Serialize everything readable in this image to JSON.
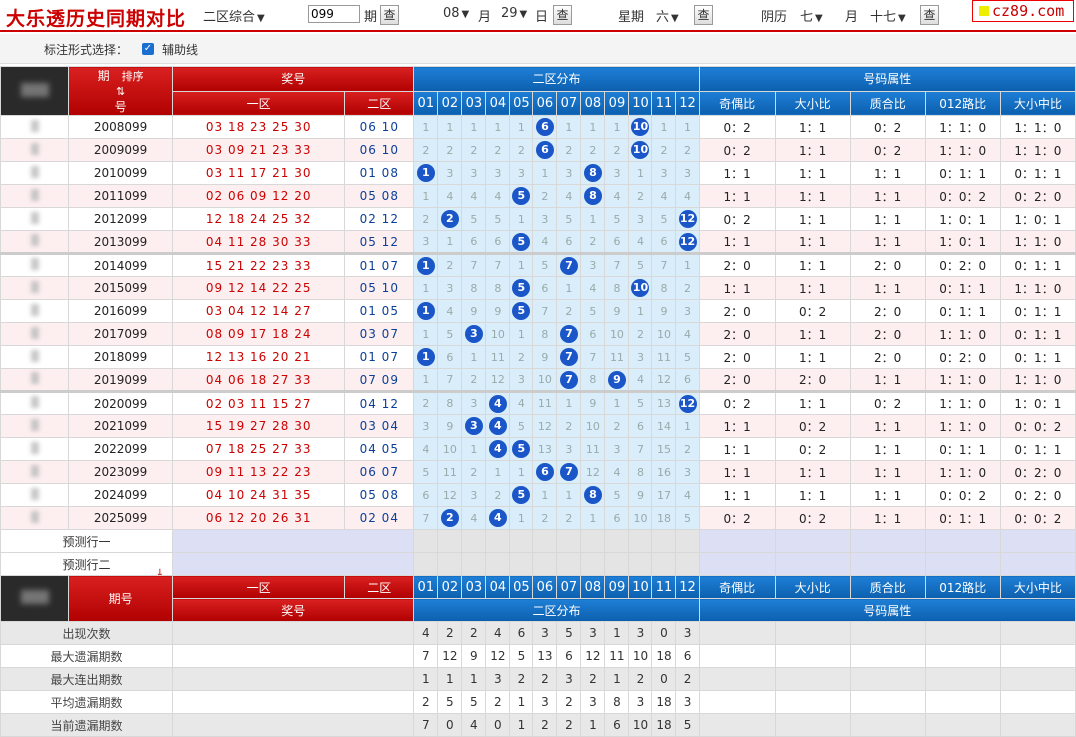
{
  "header": {
    "title": "大乐透历史同期对比",
    "zone_select": "二区综合",
    "issue_value": "099",
    "issue_label": "期",
    "query": "查",
    "month": "08",
    "month_label": "月",
    "day": "29",
    "day_label": "日",
    "weekday_label": "星期",
    "weekday": "六",
    "lunar_label": "阴历",
    "lunar_month": "七",
    "lunar_day": "十七",
    "logo": "cz89.com"
  },
  "options": {
    "label": "标注形式选择：",
    "checkbox_label": "辅助线"
  },
  "table": {
    "h_issue": "期",
    "h_issue2": "号",
    "h_sort": "排序",
    "h_prize": "奖号",
    "h_zone1": "一区",
    "h_zone2": "二区",
    "h_dist": "二区分布",
    "h_attr": "号码属性",
    "nums": [
      "01",
      "02",
      "03",
      "04",
      "05",
      "06",
      "07",
      "08",
      "09",
      "10",
      "11",
      "12"
    ],
    "attrs": [
      "奇偶比",
      "大小比",
      "质合比",
      "012路比",
      "大小中比"
    ],
    "rows": [
      {
        "issue": "2008099",
        "z1": "03 18 23 25 30",
        "z2": "06 10",
        "d": [
          "1",
          "1",
          "1",
          "1",
          "1",
          "6",
          "1",
          "1",
          "1",
          "10",
          "1",
          "1"
        ],
        "hit": [
          6,
          10
        ],
        "a": [
          "0：2",
          "1：1",
          "0：2",
          "1：1：0",
          "1：1：0"
        ]
      },
      {
        "issue": "2009099",
        "z1": "03 09 21 23 33",
        "z2": "06 10",
        "d": [
          "2",
          "2",
          "2",
          "2",
          "2",
          "6",
          "2",
          "2",
          "2",
          "10",
          "2",
          "2"
        ],
        "hit": [
          6,
          10
        ],
        "a": [
          "0：2",
          "1：1",
          "0：2",
          "1：1：0",
          "1：1：0"
        ]
      },
      {
        "issue": "2010099",
        "z1": "03 11 17 21 30",
        "z2": "01 08",
        "d": [
          "1",
          "3",
          "3",
          "3",
          "3",
          "1",
          "3",
          "8",
          "3",
          "1",
          "3",
          "3"
        ],
        "hit": [
          1,
          8
        ],
        "a": [
          "1：1",
          "1：1",
          "1：1",
          "0：1：1",
          "0：1：1"
        ]
      },
      {
        "issue": "2011099",
        "z1": "02 06 09 12 20",
        "z2": "05 08",
        "d": [
          "1",
          "4",
          "4",
          "4",
          "5",
          "2",
          "4",
          "8",
          "4",
          "2",
          "4",
          "4"
        ],
        "hit": [
          5,
          8
        ],
        "a": [
          "1：1",
          "1：1",
          "1：1",
          "0：0：2",
          "0：2：0"
        ]
      },
      {
        "issue": "2012099",
        "z1": "12 18 24 25 32",
        "z2": "02 12",
        "d": [
          "2",
          "2",
          "5",
          "5",
          "1",
          "3",
          "5",
          "1",
          "5",
          "3",
          "5",
          "12"
        ],
        "hit": [
          2,
          12
        ],
        "a": [
          "0：2",
          "1：1",
          "1：1",
          "1：0：1",
          "1：0：1"
        ]
      },
      {
        "issue": "2013099",
        "z1": "04 11 28 30 33",
        "z2": "05 12",
        "d": [
          "3",
          "1",
          "6",
          "6",
          "5",
          "4",
          "6",
          "2",
          "6",
          "4",
          "6",
          "12"
        ],
        "hit": [
          5,
          12
        ],
        "a": [
          "1：1",
          "1：1",
          "1：1",
          "1：0：1",
          "1：1：0"
        ]
      },
      {
        "issue": "2014099",
        "z1": "15 21 22 23 33",
        "z2": "01 07",
        "d": [
          "1",
          "2",
          "7",
          "7",
          "1",
          "5",
          "7",
          "3",
          "7",
          "5",
          "7",
          "1"
        ],
        "hit": [
          1,
          7
        ],
        "a": [
          "2：0",
          "1：1",
          "2：0",
          "0：2：0",
          "0：1：1"
        ]
      },
      {
        "issue": "2015099",
        "z1": "09 12 14 22 25",
        "z2": "05 10",
        "d": [
          "1",
          "3",
          "8",
          "8",
          "5",
          "6",
          "1",
          "4",
          "8",
          "10",
          "8",
          "2"
        ],
        "hit": [
          5,
          10
        ],
        "a": [
          "1：1",
          "1：1",
          "1：1",
          "0：1：1",
          "1：1：0"
        ]
      },
      {
        "issue": "2016099",
        "z1": "03 04 12 14 27",
        "z2": "01 05",
        "d": [
          "1",
          "4",
          "9",
          "9",
          "5",
          "7",
          "2",
          "5",
          "9",
          "1",
          "9",
          "3"
        ],
        "hit": [
          1,
          5
        ],
        "a": [
          "2：0",
          "0：2",
          "2：0",
          "0：1：1",
          "0：1：1"
        ]
      },
      {
        "issue": "2017099",
        "z1": "08 09 17 18 24",
        "z2": "03 07",
        "d": [
          "1",
          "5",
          "3",
          "10",
          "1",
          "8",
          "7",
          "6",
          "10",
          "2",
          "10",
          "4"
        ],
        "hit": [
          3,
          7
        ],
        "a": [
          "2：0",
          "1：1",
          "2：0",
          "1：1：0",
          "0：1：1"
        ]
      },
      {
        "issue": "2018099",
        "z1": "12 13 16 20 21",
        "z2": "01 07",
        "d": [
          "1",
          "6",
          "1",
          "11",
          "2",
          "9",
          "7",
          "7",
          "11",
          "3",
          "11",
          "5"
        ],
        "hit": [
          1,
          7
        ],
        "a": [
          "2：0",
          "1：1",
          "2：0",
          "0：2：0",
          "0：1：1"
        ]
      },
      {
        "issue": "2019099",
        "z1": "04 06 18 27 33",
        "z2": "07 09",
        "d": [
          "1",
          "7",
          "2",
          "12",
          "3",
          "10",
          "7",
          "8",
          "9",
          "4",
          "12",
          "6"
        ],
        "hit": [
          7,
          9
        ],
        "a": [
          "2：0",
          "2：0",
          "1：1",
          "1：1：0",
          "1：1：0"
        ]
      },
      {
        "issue": "2020099",
        "z1": "02 03 11 15 27",
        "z2": "04 12",
        "d": [
          "2",
          "8",
          "3",
          "4",
          "4",
          "11",
          "1",
          "9",
          "1",
          "5",
          "13",
          "12"
        ],
        "hit": [
          4,
          12
        ],
        "a": [
          "0：2",
          "1：1",
          "0：2",
          "1：1：0",
          "1：0：1"
        ]
      },
      {
        "issue": "2021099",
        "z1": "15 19 27 28 30",
        "z2": "03 04",
        "d": [
          "3",
          "9",
          "3",
          "4",
          "5",
          "12",
          "2",
          "10",
          "2",
          "6",
          "14",
          "1"
        ],
        "hit": [
          3,
          4
        ],
        "a": [
          "1：1",
          "0：2",
          "1：1",
          "1：1：0",
          "0：0：2"
        ]
      },
      {
        "issue": "2022099",
        "z1": "07 18 25 27 33",
        "z2": "04 05",
        "d": [
          "4",
          "10",
          "1",
          "4",
          "5",
          "13",
          "3",
          "11",
          "3",
          "7",
          "15",
          "2"
        ],
        "hit": [
          4,
          5
        ],
        "a": [
          "1：1",
          "0：2",
          "1：1",
          "0：1：1",
          "0：1：1"
        ]
      },
      {
        "issue": "2023099",
        "z1": "09 11 13 22 23",
        "z2": "06 07",
        "d": [
          "5",
          "11",
          "2",
          "1",
          "1",
          "6",
          "7",
          "12",
          "4",
          "8",
          "16",
          "3"
        ],
        "hit": [
          6,
          7
        ],
        "a": [
          "1：1",
          "1：1",
          "1：1",
          "1：1：0",
          "0：2：0"
        ]
      },
      {
        "issue": "2024099",
        "z1": "04 10 24 31 35",
        "z2": "05 08",
        "d": [
          "6",
          "12",
          "3",
          "2",
          "5",
          "1",
          "1",
          "8",
          "5",
          "9",
          "17",
          "4"
        ],
        "hit": [
          5,
          8
        ],
        "a": [
          "1：1",
          "1：1",
          "1：1",
          "0：0：2",
          "0：2：0"
        ]
      },
      {
        "issue": "2025099",
        "z1": "06 12 20 26 31",
        "z2": "02 04",
        "d": [
          "7",
          "2",
          "4",
          "4",
          "1",
          "2",
          "2",
          "1",
          "6",
          "10",
          "18",
          "5"
        ],
        "hit": [
          2,
          4
        ],
        "a": [
          "0：2",
          "0：2",
          "1：1",
          "0：1：1",
          "0：0：2"
        ]
      }
    ],
    "pred": [
      "预测行一",
      "预测行二"
    ],
    "stats": [
      {
        "label": "出现次数",
        "v": [
          "4",
          "2",
          "2",
          "4",
          "6",
          "3",
          "5",
          "3",
          "1",
          "3",
          "0",
          "3"
        ]
      },
      {
        "label": "最大遗漏期数",
        "v": [
          "7",
          "12",
          "9",
          "12",
          "5",
          "13",
          "6",
          "12",
          "11",
          "10",
          "18",
          "6"
        ]
      },
      {
        "label": "最大连出期数",
        "v": [
          "1",
          "1",
          "1",
          "3",
          "2",
          "2",
          "3",
          "2",
          "1",
          "2",
          "0",
          "2"
        ]
      },
      {
        "label": "平均遗漏期数",
        "v": [
          "2",
          "5",
          "5",
          "2",
          "1",
          "3",
          "2",
          "3",
          "8",
          "3",
          "18",
          "3"
        ]
      },
      {
        "label": "当前遗漏期数",
        "v": [
          "7",
          "0",
          "4",
          "0",
          "1",
          "2",
          "2",
          "1",
          "6",
          "10",
          "18",
          "5"
        ]
      }
    ]
  }
}
